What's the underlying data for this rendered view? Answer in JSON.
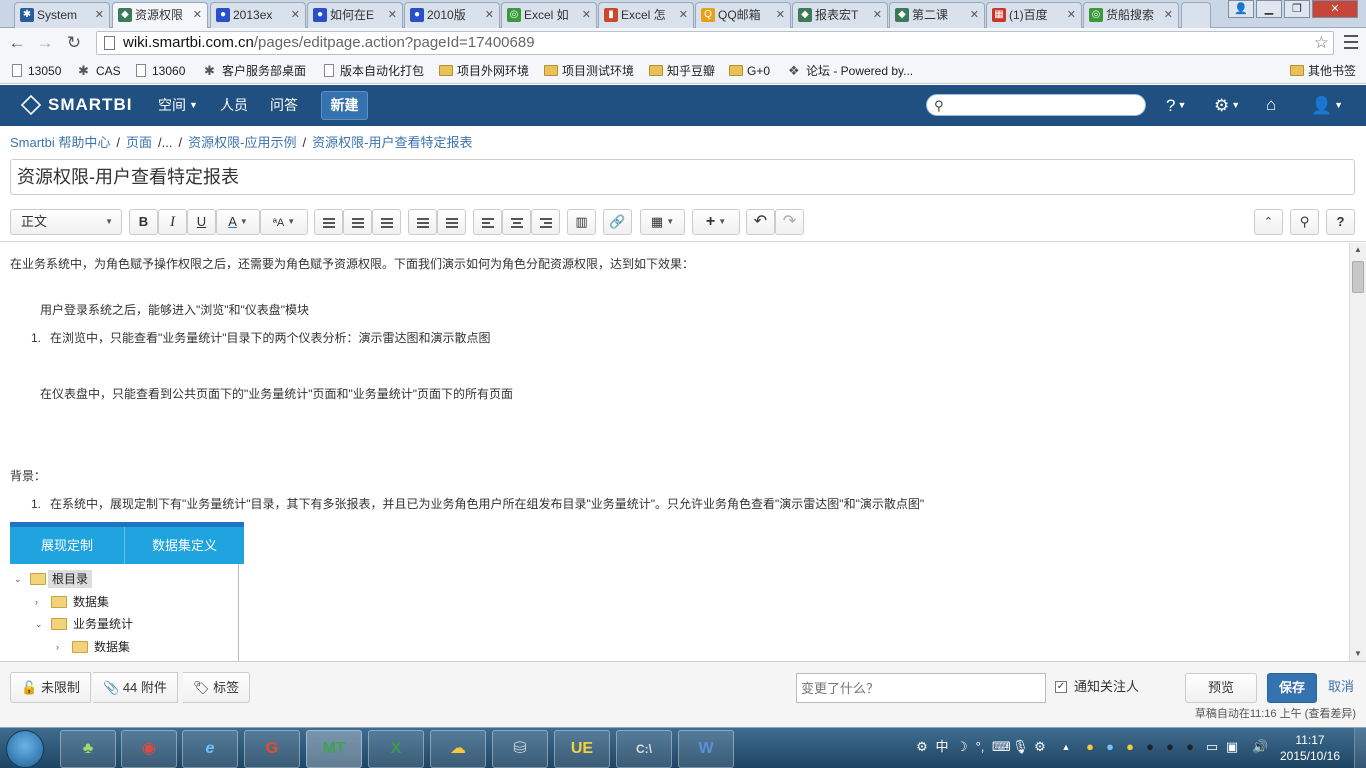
{
  "browser": {
    "tabs": [
      {
        "label": "System",
        "icon": "smartbi-person-icon",
        "color": "#2b5c9e"
      },
      {
        "label": "资源权限",
        "icon": "confluence-icon",
        "color": "#3d7a5a"
      },
      {
        "label": "2013ex",
        "icon": "baidu-paw-icon",
        "color": "#2b4fc7"
      },
      {
        "label": "如何在E",
        "icon": "baidu-paw-icon",
        "color": "#2b4fc7"
      },
      {
        "label": "2010版",
        "icon": "baidu-paw-icon",
        "color": "#2b4fc7"
      },
      {
        "label": "Excel 如",
        "icon": "globe-icon",
        "color": "#3a9a3a"
      },
      {
        "label": "Excel 怎",
        "icon": "chart-icon",
        "color": "#c94a2a"
      },
      {
        "label": "QQ邮箱",
        "icon": "qq-mail-icon",
        "color": "#e3a21a"
      },
      {
        "label": "报表宏T",
        "icon": "confluence-icon",
        "color": "#3d7a5a"
      },
      {
        "label": "第二课",
        "icon": "confluence-icon",
        "color": "#3d7a5a"
      },
      {
        "label": "(1)百度",
        "icon": "colorful-icon",
        "color": "#c8372d"
      },
      {
        "label": "货船搜索",
        "icon": "globe-icon",
        "color": "#3a9a3a"
      }
    ],
    "url_host": "wiki.smartbi.com.cn",
    "url_path": "/pages/editpage.action?pageId=17400689",
    "bookmarks": [
      {
        "label": "13050",
        "icon": "page"
      },
      {
        "label": "CAS",
        "icon": "logo"
      },
      {
        "label": "13060",
        "icon": "page"
      },
      {
        "label": "客户服务部桌面",
        "icon": "logo"
      },
      {
        "label": "版本自动化打包",
        "icon": "page"
      },
      {
        "label": "项目外网环境",
        "icon": "folder"
      },
      {
        "label": "项目测试环境",
        "icon": "folder"
      },
      {
        "label": "知乎豆瓣",
        "icon": "folder"
      },
      {
        "label": "G+0",
        "icon": "folder"
      },
      {
        "label": "论坛 - Powered by...",
        "icon": "logo"
      }
    ],
    "other_bookmarks": "其他书签"
  },
  "app": {
    "logo": "SMARTBI",
    "nav": {
      "spaces": "空间",
      "people": "人员",
      "qa": "问答",
      "create": "新建"
    },
    "accent": "#205081",
    "button_blue": "#3572b0"
  },
  "breadcrumb": {
    "items": [
      "Smartbi 帮助中心",
      "页面",
      "...",
      "资源权限-应用示例",
      "资源权限-用户查看特定报表"
    ]
  },
  "page": {
    "title": "资源权限-用户查看特定报表"
  },
  "toolbar": {
    "style_select": "正文",
    "bold": "B",
    "italic": "I",
    "underline": "U",
    "color": "A"
  },
  "content": {
    "intro": "在业务系统中，为角色赋予操作权限之后，还需要为角色赋予资源权限。下面我们演示如何为角色分配资源权限，达到如下效果：",
    "line1": "用户登录系统之后，能够进入\"浏览\"和\"仪表盘\"模块",
    "item1_num": "1.",
    "item1": "在浏览中，只能查看\"业务量统计\"目录下的两个仪表分析：演示雷达图和演示散点图",
    "line2": "在仪表盘中，只能查看到公共页面下的\"业务量统计\"页面和\"业务量统计\"页面下的所有页面",
    "background_label": "背景：",
    "item2_num": "1.",
    "item2": "在系统中，展现定制下有\"业务量统计\"目录，其下有多张报表，并且已为业务角色用户所在组发布目录\"业务量统计\"。只允许业务角色查看\"演示雷达图\"和\"演示散点图\"",
    "embed": {
      "tab1": "展现定制",
      "tab2": "数据集定义",
      "tab_color": "#1fa4e0",
      "tree": [
        {
          "label": "根目录",
          "twisty": "expanded",
          "selected": true
        },
        {
          "label": "数据集",
          "twisty": "collapsed"
        },
        {
          "label": "业务量统计",
          "twisty": "expanded"
        },
        {
          "label": "数据集",
          "twisty": "collapsed"
        }
      ]
    }
  },
  "footer": {
    "restrictions": "未限制",
    "attachments": "44 附件",
    "labels": "标签",
    "change_placeholder": "变更了什么？",
    "notify_label": "通知关注人",
    "notify_checked": true,
    "preview": "预览",
    "save": "保存",
    "cancel": "取消",
    "autosave": "草稿自动在11:16 上午 (查看差异)"
  },
  "taskbar": {
    "apps": [
      "clover",
      "chrome",
      "ie",
      "app-g",
      "mt",
      "excel",
      "cloud",
      "db",
      "ue",
      "cmd",
      "word"
    ],
    "time": "11:17",
    "date": "2015/10/16",
    "ime": "中"
  }
}
